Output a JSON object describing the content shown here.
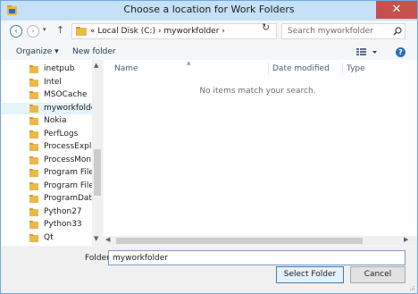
{
  "window": {
    "title": "Choose a location for Work Folders",
    "close_symbol": "✕"
  },
  "navigation": {
    "back_symbol": "‹",
    "forward_symbol": "›",
    "recent_symbol": "▾",
    "up_symbol": "↑",
    "refresh_symbol": "↻",
    "address_dropdown_symbol": "▾",
    "address_path": "«  Local Disk (C:)  ›  myworkfolder  ›"
  },
  "search": {
    "placeholder": "Search myworkfolder"
  },
  "toolbar": {
    "organize_label": "Organize ▾",
    "new_folder_label": "New folder",
    "help_symbol": "?"
  },
  "sidebar": {
    "items": [
      {
        "label": "inetpub"
      },
      {
        "label": "Intel"
      },
      {
        "label": "MSOCache"
      },
      {
        "label": "myworkfolder"
      },
      {
        "label": "Nokia"
      },
      {
        "label": "PerfLogs"
      },
      {
        "label": "ProcessExplore"
      },
      {
        "label": "ProcessMonito"
      },
      {
        "label": "Program Files"
      },
      {
        "label": "Program Files ("
      },
      {
        "label": "ProgramData"
      },
      {
        "label": "Python27"
      },
      {
        "label": "Python33"
      },
      {
        "label": "Qt"
      }
    ],
    "selected_index": 3
  },
  "content": {
    "columns": {
      "name": "Name",
      "date_modified": "Date modified",
      "type": "Type"
    },
    "empty_message": "No items match your search."
  },
  "footer": {
    "folder_label": "Folder:",
    "folder_value": "myworkfolder",
    "select_button": "Select Folder",
    "cancel_button": "Cancel"
  },
  "colors": {
    "titlebar": "#c5e0f7",
    "close_button": "#c7504c",
    "folder_icon": "#e9b949",
    "accent": "#3c7fb1"
  }
}
